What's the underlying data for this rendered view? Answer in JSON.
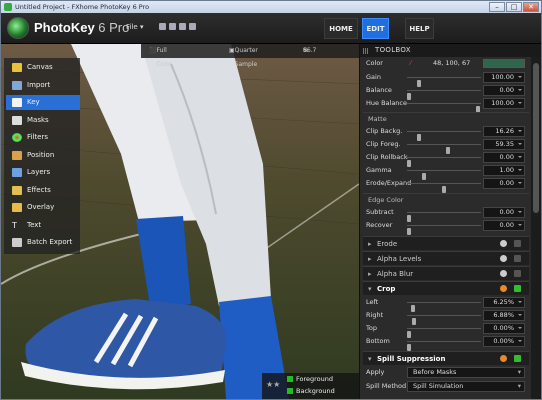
{
  "window": {
    "title": "Untitled Project - FXhome PhotoKey 6 Pro",
    "minimize": "–",
    "maximize": "□",
    "close": "✕"
  },
  "app": {
    "name": "PhotoKey",
    "version": "6 Pro",
    "file_menu": "File"
  },
  "nav": {
    "home": "HOME",
    "edit": "EDIT",
    "help": "HELP"
  },
  "view_bar": {
    "color_mode": "Full Color",
    "quality": "Quarter Sample",
    "zoom": "66.7"
  },
  "sidebar": {
    "items": [
      {
        "label": "Canvas"
      },
      {
        "label": "Import"
      },
      {
        "label": "Key"
      },
      {
        "label": "Masks"
      },
      {
        "label": "Filters"
      },
      {
        "label": "Position"
      },
      {
        "label": "Layers"
      },
      {
        "label": "Effects"
      },
      {
        "label": "Overlay"
      },
      {
        "label": "Text"
      },
      {
        "label": "Batch Export"
      }
    ],
    "active": "Key"
  },
  "layers": {
    "foreground": "Foreground",
    "background": "Background"
  },
  "toolbox": {
    "title": "TOOLBOX",
    "color": {
      "label": "Color",
      "value": "48, 100, 67",
      "swatch": "#30644b"
    },
    "gain": {
      "label": "Gain",
      "value": "100.00",
      "level": 0.14
    },
    "balance": {
      "label": "Balance",
      "value": "0.00",
      "level": 0.0
    },
    "hue_balance": {
      "label": "Hue Balance",
      "value": "100.00",
      "level": 0.98
    },
    "matte_header": "Matte",
    "clip_back": {
      "label": "Clip Backg.",
      "value": "16.26",
      "level": 0.14
    },
    "clip_fore": {
      "label": "Clip Foreg.",
      "value": "59.35",
      "level": 0.56
    },
    "clip_rollback": {
      "label": "Clip Rollback",
      "value": "0.00",
      "level": 0.0
    },
    "gamma": {
      "label": "Gamma",
      "value": "1.00",
      "level": 0.22
    },
    "erode_expand": {
      "label": "Erode/Expand",
      "value": "0.00",
      "level": 0.5
    },
    "edge_header": "Edge Color",
    "subtract": {
      "label": "Subtract",
      "value": "0.00",
      "level": 0.0
    },
    "recover": {
      "label": "Recover",
      "value": "0.00",
      "level": 0.0
    },
    "sections": {
      "erode": "Erode",
      "alpha_levels": "Alpha Levels",
      "alpha_blur": "Alpha Blur",
      "crop": "Crop",
      "spill": "Spill Suppression"
    },
    "crop_left": {
      "label": "Left",
      "value": "6.25%",
      "level": 0.06
    },
    "crop_right": {
      "label": "Right",
      "value": "6.88%",
      "level": 0.07
    },
    "crop_top": {
      "label": "Top",
      "value": "0.00%",
      "level": 0.0
    },
    "crop_bottom": {
      "label": "Bottom",
      "value": "0.00%",
      "level": 0.0
    },
    "apply": {
      "label": "Apply",
      "value": "Before Masks"
    },
    "spill_method": {
      "label": "Spill Method",
      "value": "Spill Simulation"
    }
  }
}
